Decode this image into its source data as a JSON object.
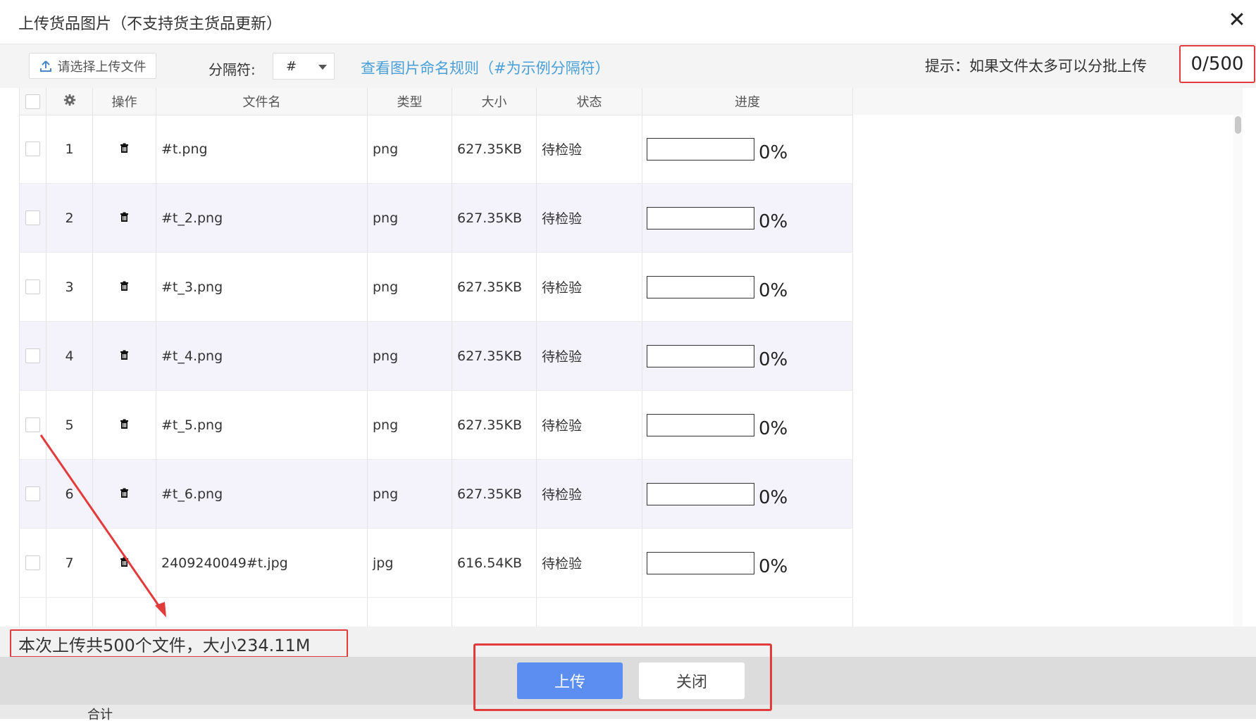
{
  "dialog": {
    "title": "上传货品图片（不支持货主货品更新）"
  },
  "toolbar": {
    "choose_button": "请选择上传文件",
    "separator_label": "分隔符:",
    "separator_value": "#",
    "rule_link": "查看图片命名规则（#为示例分隔符）",
    "hint": "提示：如果文件太多可以分批上传",
    "count": "0/500"
  },
  "table": {
    "headers": {
      "op": "操作",
      "name": "文件名",
      "type": "类型",
      "size": "大小",
      "status": "状态",
      "progress": "进度"
    },
    "rows": [
      {
        "idx": "1",
        "name": "#t.png",
        "type": "png",
        "size": "627.35KB",
        "status": "待检验",
        "progress": "0%"
      },
      {
        "idx": "2",
        "name": "#t_2.png",
        "type": "png",
        "size": "627.35KB",
        "status": "待检验",
        "progress": "0%"
      },
      {
        "idx": "3",
        "name": "#t_3.png",
        "type": "png",
        "size": "627.35KB",
        "status": "待检验",
        "progress": "0%"
      },
      {
        "idx": "4",
        "name": "#t_4.png",
        "type": "png",
        "size": "627.35KB",
        "status": "待检验",
        "progress": "0%"
      },
      {
        "idx": "5",
        "name": "#t_5.png",
        "type": "png",
        "size": "627.35KB",
        "status": "待检验",
        "progress": "0%"
      },
      {
        "idx": "6",
        "name": "#t_6.png",
        "type": "png",
        "size": "627.35KB",
        "status": "待检验",
        "progress": "0%"
      },
      {
        "idx": "7",
        "name": "2409240049#t.jpg",
        "type": "jpg",
        "size": "616.54KB",
        "status": "待检验",
        "progress": "0%"
      }
    ]
  },
  "summary": "本次上传共500个文件，大小234.11M",
  "footer": {
    "upload_button": "上传",
    "close_button": "关闭",
    "total_label": "合计"
  },
  "colors": {
    "accent_blue": "#5b8ef0",
    "link_blue": "#4a9fd8",
    "annotation_red": "#e23b3b",
    "alt_row": "#f4f2fb"
  }
}
